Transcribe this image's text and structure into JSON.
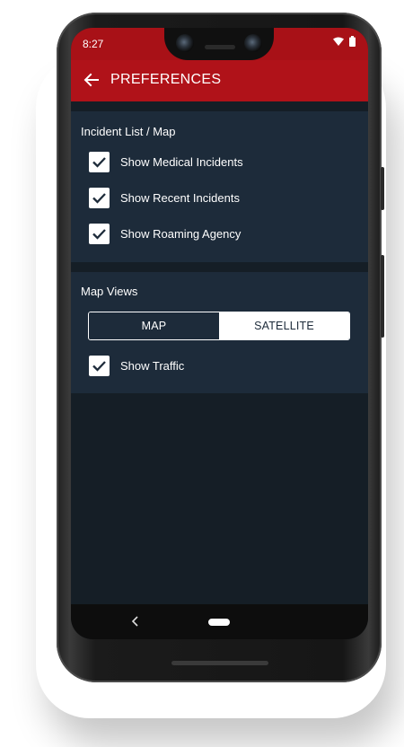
{
  "status_bar": {
    "time": "8:27",
    "icons": [
      "wifi-icon",
      "battery-icon"
    ]
  },
  "app_bar": {
    "back_icon": "arrow-left-icon",
    "title": "PREFERENCES"
  },
  "sections": {
    "incident": {
      "title": "Incident List / Map",
      "items": [
        {
          "label": "Show Medical Incidents",
          "checked": true
        },
        {
          "label": "Show Recent Incidents",
          "checked": true
        },
        {
          "label": "Show Roaming Agency",
          "checked": true
        }
      ]
    },
    "map_views": {
      "title": "Map Views",
      "segments": {
        "map": "MAP",
        "satellite": "SATELLITE",
        "selected": "satellite"
      },
      "items": [
        {
          "label": "Show Traffic",
          "checked": true
        }
      ]
    }
  },
  "nav_bar": {
    "back_icon": "nav-back-icon",
    "home_icon": "nav-home-pill"
  },
  "colors": {
    "brand_red": "#b01219",
    "section_bg": "#1d2b3a",
    "screen_bg": "#151e26"
  }
}
